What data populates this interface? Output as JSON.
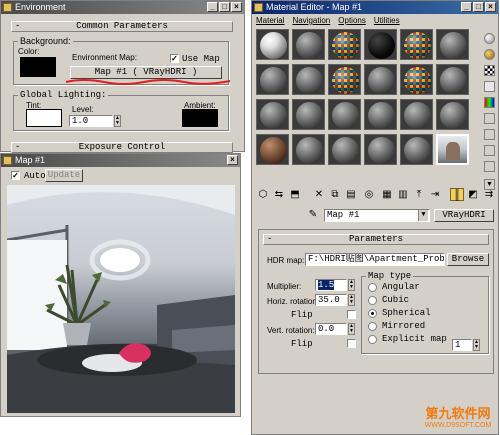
{
  "environment_window": {
    "title": "Environment",
    "rollout_common": "Common Parameters",
    "background_group": "Background:",
    "color_label": "Color:",
    "env_map_label": "Environment Map:",
    "use_map_label": "Use Map",
    "use_map_checked": true,
    "env_map_button": "Map #1   ( VRayHDRI )",
    "global_lighting_group": "Global Lighting:",
    "tint_label": "Tint:",
    "level_label": "Level:",
    "level_value": "1.0",
    "ambient_label": "Ambient:",
    "rollout_exposure": "Exposure Control",
    "colors": {
      "background": "#000000",
      "tint": "#ffffff",
      "ambient": "#000000",
      "annotation": "#e02020"
    }
  },
  "preview_window": {
    "title": "Map #1",
    "auto_label": "Auto",
    "auto_checked": true,
    "update_button": "Update"
  },
  "material_editor": {
    "title": "Material Editor - Map #1",
    "menu": [
      "Material",
      "Navigation",
      "Options",
      "Utilities"
    ],
    "slots": [
      "white",
      "gray",
      "checker",
      "black",
      "checker",
      "gray",
      "gray",
      "gray",
      "checker",
      "gray",
      "checker",
      "gray",
      "gray",
      "gray",
      "gray",
      "gray",
      "gray",
      "gray",
      "brown",
      "gray",
      "gray",
      "gray",
      "gray",
      "photo"
    ],
    "map_name": "Map #1",
    "map_type_button": "VRayHDRI",
    "parameters_rollout": "Parameters",
    "hdr_map_label": "HDR map:",
    "hdr_map_value": "F:\\HDRI贴图\\Apartment_Prob",
    "browse_button": "Browse",
    "multiplier_label": "Multiplier:",
    "multiplier_value": "1.5",
    "horiz_rotation_label": "Horiz. rotation:",
    "horiz_rotation_value": "35.0",
    "flip_label_1": "Flip",
    "vert_rotation_label": "Vert. rotation:",
    "vert_rotation_value": "0.0",
    "flip_label_2": "Flip",
    "map_type_group": "Map type",
    "map_types": [
      {
        "label": "Angular",
        "selected": false
      },
      {
        "label": "Cubic",
        "selected": false
      },
      {
        "label": "Spherical",
        "selected": true
      },
      {
        "label": "Mirrored",
        "selected": false
      },
      {
        "label": "Explicit map",
        "selected": false
      }
    ],
    "explicit_map_channel": "1"
  },
  "watermark": {
    "brand": "第九软件网",
    "url": "WWW.D9SOFT.COM"
  }
}
